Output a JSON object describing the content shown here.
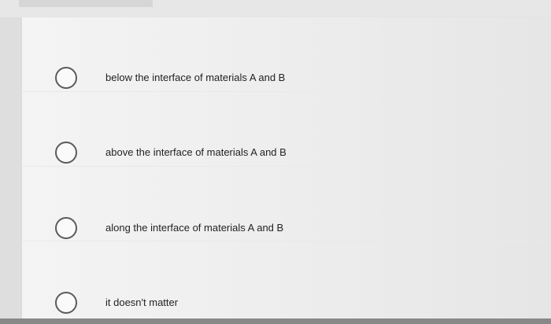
{
  "question": {
    "options": [
      {
        "label": "below the interface of materials A and B",
        "selected": false
      },
      {
        "label": "above the interface of materials A and B",
        "selected": false
      },
      {
        "label": "along the interface of materials A and B",
        "selected": false
      },
      {
        "label": "it doesn't matter",
        "selected": false
      }
    ]
  },
  "colors": {
    "panel_bg": "#f1f1f1",
    "page_bg": "#dedede",
    "radio_border": "#5b5b5b",
    "text": "#232323"
  },
  "icons": {
    "radio": "radio-button-unchecked-icon"
  }
}
